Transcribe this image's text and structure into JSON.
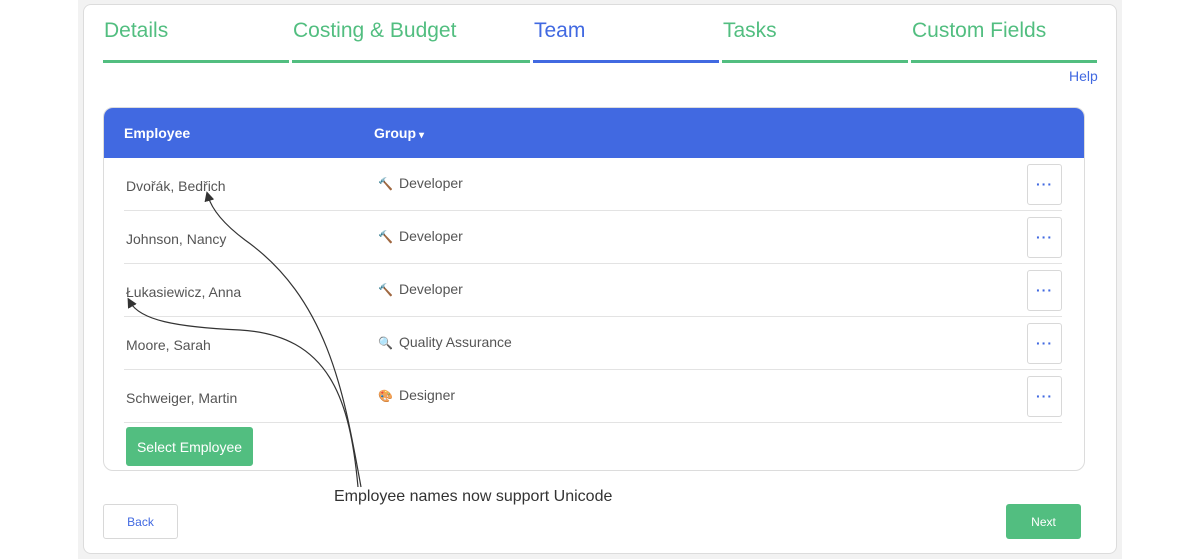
{
  "tabs": [
    {
      "label": "Details",
      "active": false
    },
    {
      "label": "Costing & Budget",
      "active": false
    },
    {
      "label": "Team",
      "active": true
    },
    {
      "label": "Tasks",
      "active": false
    },
    {
      "label": "Custom Fields",
      "active": false
    }
  ],
  "help_label": "Help",
  "table": {
    "headers": {
      "employee": "Employee",
      "group": "Group",
      "group_sort_glyph": "▾"
    },
    "rows": [
      {
        "name": "Dvořák, Bedřich",
        "group": "Developer",
        "icon": "hammer-icon",
        "icon_glyph": "🔨",
        "action": "···"
      },
      {
        "name": "Johnson, Nancy",
        "group": "Developer",
        "icon": "hammer-icon",
        "icon_glyph": "🔨",
        "action": "···"
      },
      {
        "name": "Łukasiewicz, Anna",
        "group": "Developer",
        "icon": "hammer-icon",
        "icon_glyph": "🔨",
        "action": "···"
      },
      {
        "name": "Moore, Sarah",
        "group": "Quality Assurance",
        "icon": "magnifier-icon",
        "icon_glyph": "🔍",
        "action": "···"
      },
      {
        "name": "Schweiger, Martin",
        "group": "Designer",
        "icon": "palette-icon",
        "icon_glyph": "🎨",
        "action": "···"
      }
    ]
  },
  "select_employee_label": "Select Employee",
  "annotation": "Employee names now support Unicode",
  "footer": {
    "back_label": "Back",
    "next_label": "Next"
  },
  "colors": {
    "accent_blue": "#4169e1",
    "accent_green": "#52be80"
  }
}
